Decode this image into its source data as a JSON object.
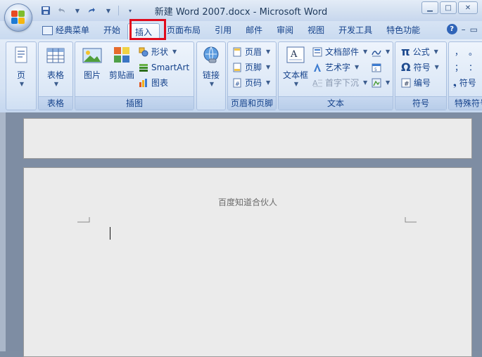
{
  "window": {
    "title": "新建 Word 2007.docx - Microsoft Word",
    "controls": [
      "minimize",
      "maximize",
      "close"
    ]
  },
  "quick_access": {
    "icons": [
      "save-icon",
      "undo-icon",
      "redo-icon",
      "customize-icon"
    ]
  },
  "tabs": [
    {
      "label": "经典菜单",
      "active": false
    },
    {
      "label": "开始",
      "active": false
    },
    {
      "label": "插入",
      "active": true
    },
    {
      "label": "页面布局",
      "active": false
    },
    {
      "label": "引用",
      "active": false
    },
    {
      "label": "邮件",
      "active": false
    },
    {
      "label": "审阅",
      "active": false
    },
    {
      "label": "视图",
      "active": false
    },
    {
      "label": "开发工具",
      "active": false
    },
    {
      "label": "特色功能",
      "active": false
    }
  ],
  "ribbon": {
    "pages": {
      "label": "页",
      "group": ""
    },
    "tables": {
      "button": "表格",
      "group": "表格"
    },
    "illustrations": {
      "group": "插图",
      "picture": "图片",
      "clipart": "剪贴画",
      "shapes": "形状",
      "smartart": "SmartArt",
      "chart": "图表"
    },
    "links": {
      "button": "链接",
      "group": ""
    },
    "header_footer": {
      "group": "页眉和页脚",
      "header": "页眉",
      "footer": "页脚",
      "page_number": "页码"
    },
    "text": {
      "group": "文本",
      "textbox": "文本框",
      "quickparts": "文档部件",
      "wordart": "艺术字",
      "dropcap": "首字下沉"
    },
    "symbols": {
      "group": "符号",
      "equation": "公式",
      "symbol": "符号",
      "numbering": "编号"
    },
    "special_symbols": {
      "group": "特殊符号",
      "symbol": "符号",
      "chars": [
        "，",
        "。",
        "；",
        "："
      ]
    }
  },
  "document": {
    "watermark_text": "百度知道合伙人"
  },
  "colors": {
    "highlight": "#e00b1c",
    "ribbon_text": "#15428b"
  }
}
